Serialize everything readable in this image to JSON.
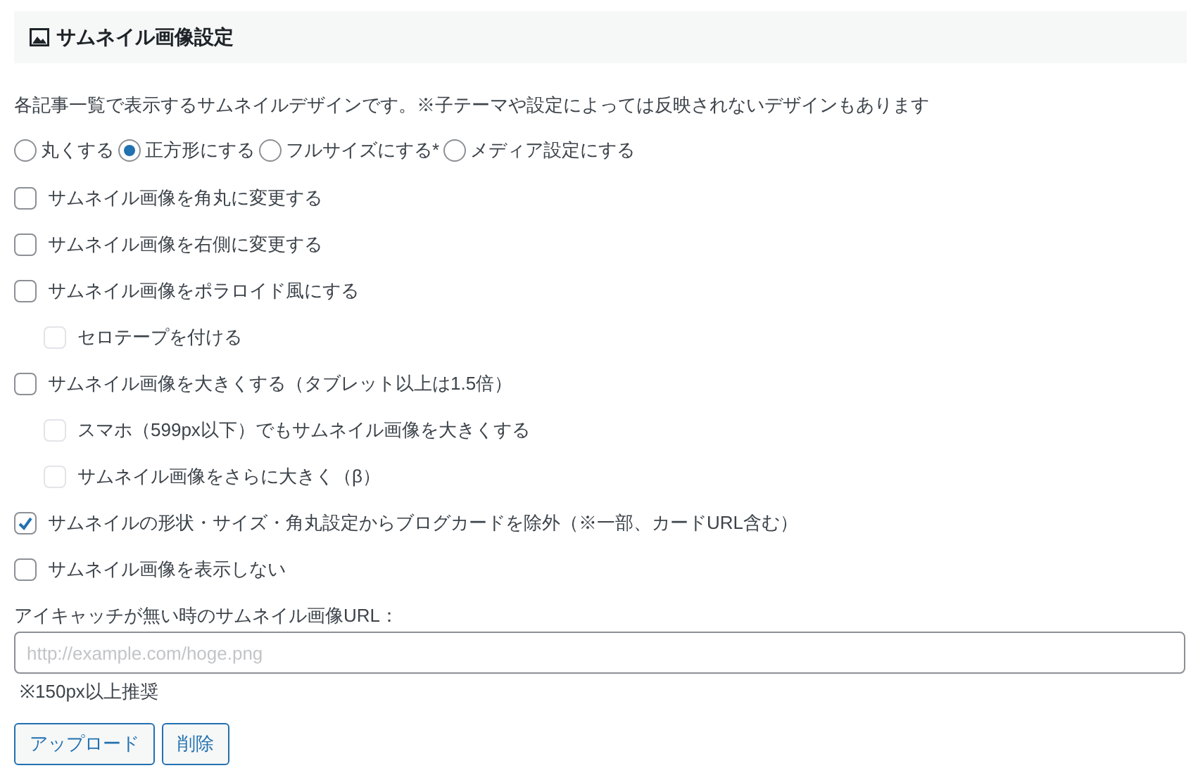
{
  "section": {
    "title": "サムネイル画像設定"
  },
  "description": "各記事一覧で表示するサムネイルデザインです。※子テーマや設定によっては反映されないデザインもあります",
  "shape_options": [
    {
      "label": "丸くする",
      "selected": false
    },
    {
      "label": "正方形にする",
      "selected": true
    },
    {
      "label": "フルサイズにする*",
      "selected": false
    },
    {
      "label": "メディア設定にする",
      "selected": false
    }
  ],
  "options": [
    {
      "label": "サムネイル画像を角丸に変更する",
      "checked": false,
      "disabled": false
    },
    {
      "label": "サムネイル画像を右側に変更する",
      "checked": false,
      "disabled": false
    },
    {
      "label": "サムネイル画像をポラロイド風にする",
      "checked": false,
      "disabled": false,
      "children": [
        {
          "label": "セロテープを付ける",
          "checked": false,
          "disabled": true
        }
      ]
    },
    {
      "label": "サムネイル画像を大きくする（タブレット以上は1.5倍）",
      "checked": false,
      "disabled": false,
      "children": [
        {
          "label": "スマホ（599px以下）でもサムネイル画像を大きくする",
          "checked": false,
          "disabled": true
        },
        {
          "label": "サムネイル画像をさらに大きく（β）",
          "checked": false,
          "disabled": true
        }
      ]
    },
    {
      "label": "サムネイルの形状・サイズ・角丸設定からブログカードを除外（※一部、カードURL含む）",
      "checked": true,
      "disabled": false
    },
    {
      "label": "サムネイル画像を表示しない",
      "checked": false,
      "disabled": false
    }
  ],
  "url_field": {
    "label": "アイキャッチが無い時のサムネイル画像URL：",
    "placeholder": "http://example.com/hoge.png",
    "note": "※150px以上推奨"
  },
  "buttons": [
    "アップロード",
    "削除"
  ]
}
